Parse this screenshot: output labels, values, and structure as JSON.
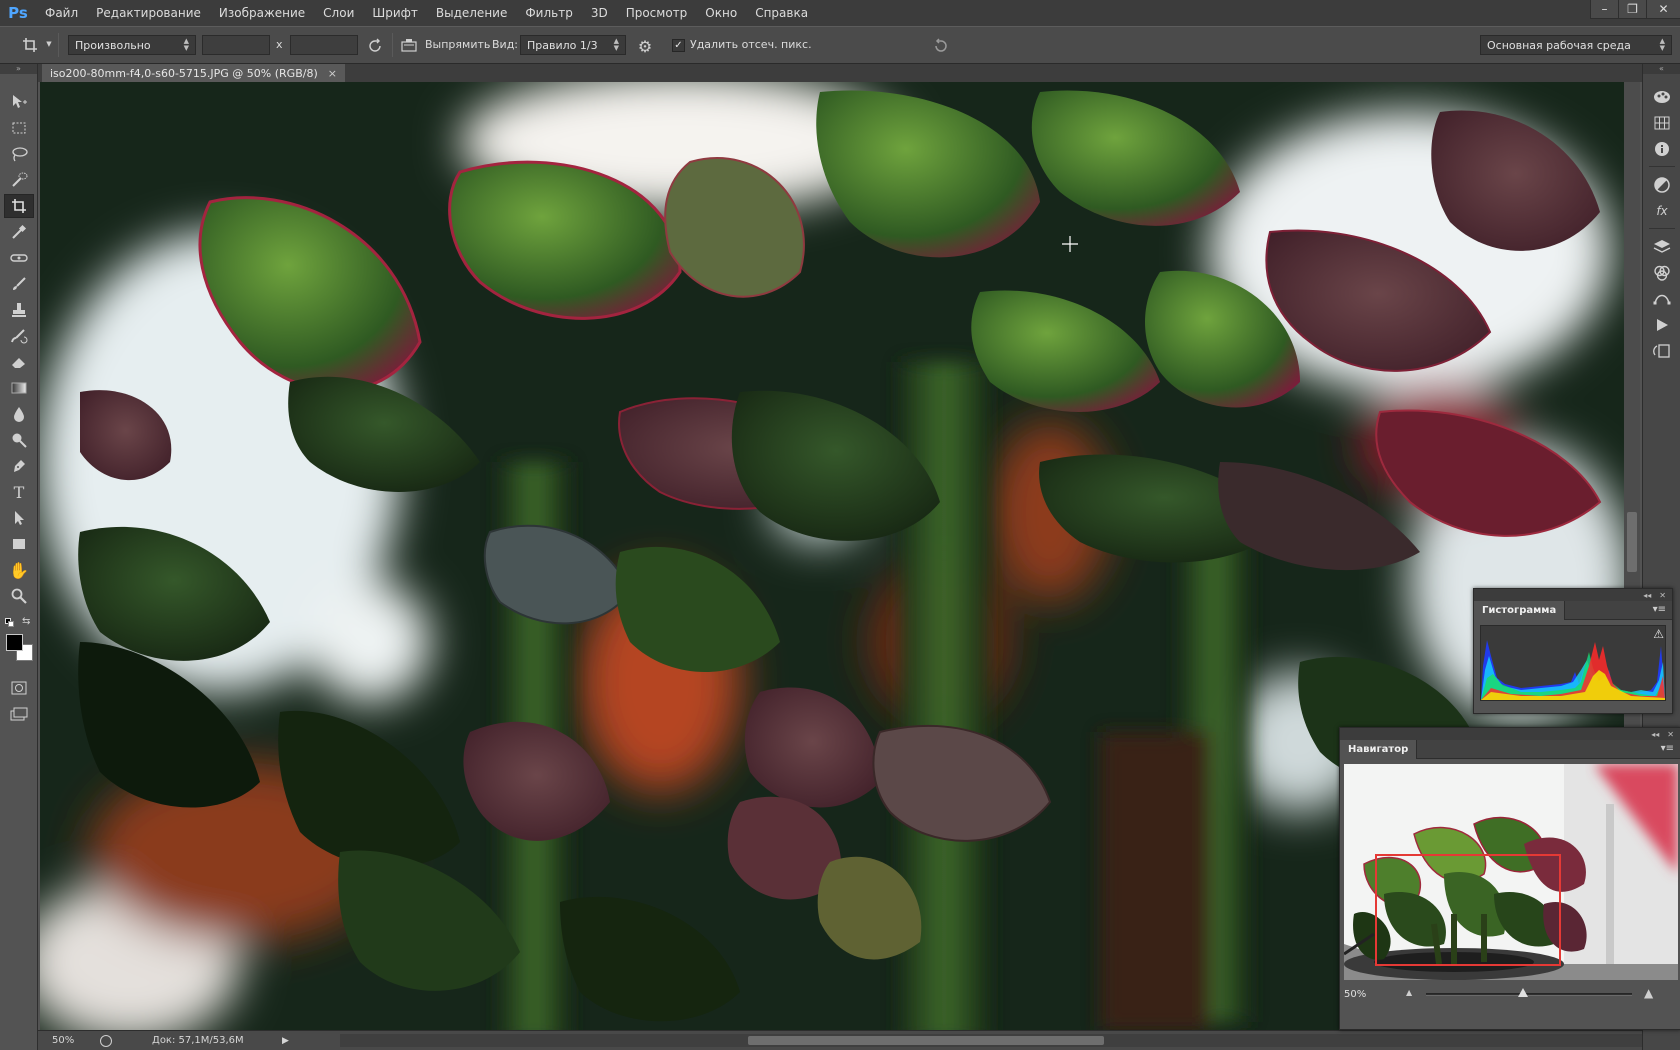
{
  "app": {
    "logo": "Ps"
  },
  "menu": {
    "items": [
      "Файл",
      "Редактирование",
      "Изображение",
      "Слои",
      "Шрифт",
      "Выделение",
      "Фильтр",
      "3D",
      "Просмотр",
      "Окно",
      "Справка"
    ]
  },
  "window_controls": {
    "minimize": "–",
    "restore": "❐",
    "close": "✕"
  },
  "options": {
    "ratio_select": "Произвольно",
    "width_value": "",
    "height_value": "",
    "times_label": "x",
    "straighten_label": "Выпрямить",
    "view_label": "Вид:",
    "view_select": "Правило 1/3",
    "delete_cropped_label": "Удалить отсеч. пикс.",
    "delete_cropped_checked": true,
    "workspace_select": "Основная рабочая среда"
  },
  "document": {
    "tab_title": "iso200-80mm-f4,0-s60-5715.JPG @ 50% (RGB/8)",
    "tab_close": "×"
  },
  "status": {
    "zoom": "50%",
    "doc_size": "Док: 57,1M/53,6M",
    "arrow": "▶"
  },
  "histogram_panel": {
    "title": "Гистограмма",
    "warning": "⚠"
  },
  "navigator_panel": {
    "title": "Навигатор",
    "zoom": "50%",
    "zoom_fraction": 0.47
  },
  "colors": {
    "foreground": "#000000",
    "background": "#ffffff",
    "nav_view_rect": "#e53935"
  },
  "tools": [
    "move-icon",
    "marquee-icon",
    "lasso-icon",
    "quick-select-icon",
    "crop-icon",
    "eyedropper-icon",
    "healing-icon",
    "brush-icon",
    "stamp-icon",
    "history-brush-icon",
    "eraser-icon",
    "gradient-icon",
    "blur-icon",
    "dodge-icon",
    "pen-icon",
    "type-icon",
    "path-select-icon",
    "rectangle-icon",
    "hand-icon",
    "zoom-icon"
  ],
  "dock_icons": [
    "color-panel-icon",
    "swatches-icon",
    "info-icon",
    "adjustments-icon",
    "styles-icon",
    "layers-icon",
    "channels-icon",
    "paths-icon",
    "actions-icon",
    "history-icon"
  ]
}
